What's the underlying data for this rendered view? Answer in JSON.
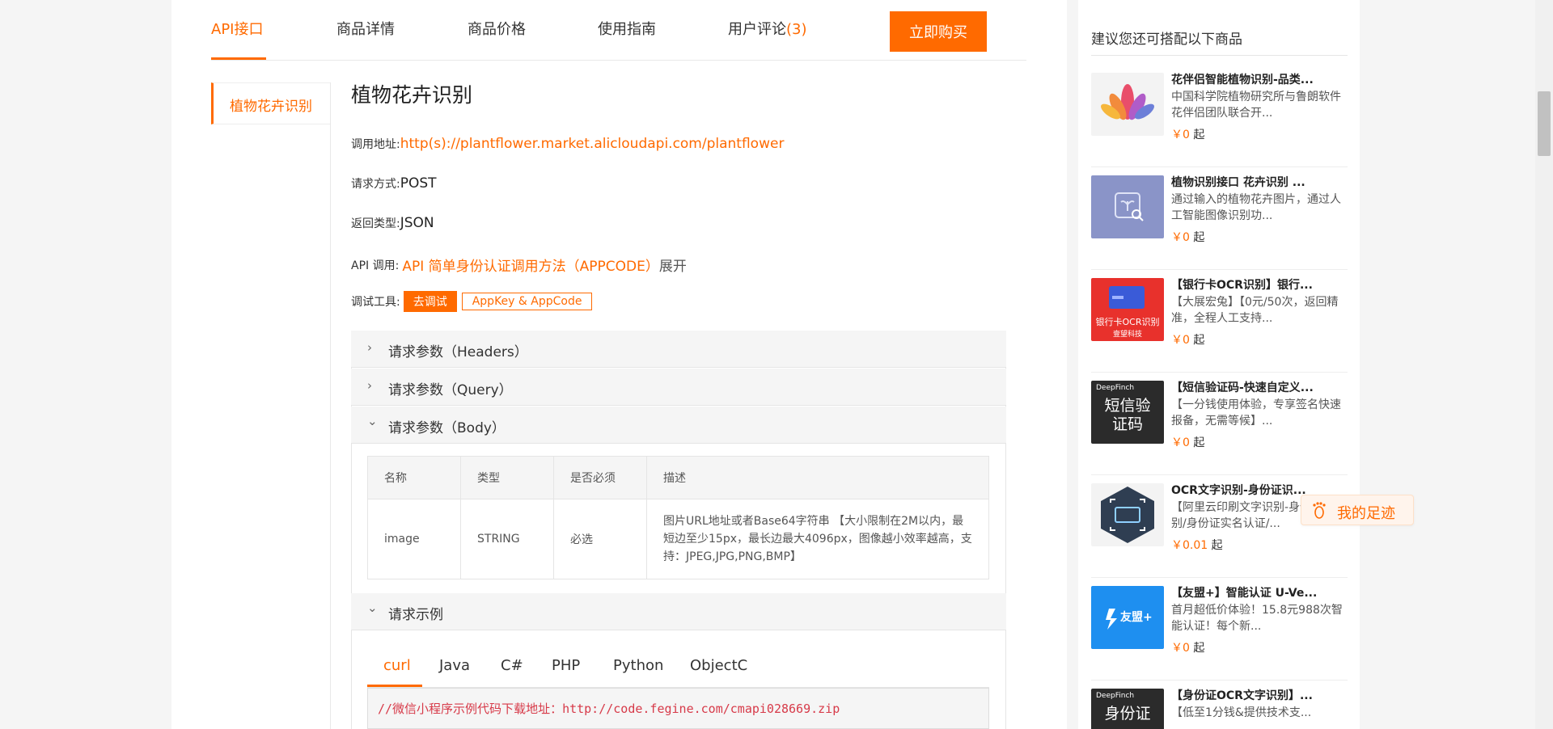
{
  "tabs": [
    {
      "label": "API接口"
    },
    {
      "label": "商品详情"
    },
    {
      "label": "商品价格"
    },
    {
      "label": "使用指南"
    },
    {
      "label": "用户评论",
      "count": "(3)"
    }
  ],
  "buy_button": "立即购买",
  "left_nav": {
    "item": "植物花卉识别"
  },
  "api": {
    "title": "植物花卉识别",
    "address_label": "调用地址:",
    "address": "http(s)://plantflower.market.alicloudapi.com/plantflower",
    "method_label": "请求方式:",
    "method": "POST",
    "return_label": "返回类型:",
    "return_type": "JSON",
    "call_label": "API 调用:",
    "call_link": "API 简单身份认证调用方法（APPCODE）",
    "call_expand": "展开",
    "tool_label": "调试工具:",
    "debug_button": "去调试",
    "appkey_button": "AppKey & AppCode"
  },
  "sections": [
    {
      "label": "请求参数（Headers）",
      "chevron": "›"
    },
    {
      "label": "请求参数（Query）",
      "chevron": "›"
    },
    {
      "label": "请求参数（Body）",
      "chevron": "⌄"
    },
    {
      "label": "请求示例",
      "chevron": "⌄"
    }
  ],
  "param_table": {
    "headers": [
      "名称",
      "类型",
      "是否必须",
      "描述"
    ],
    "rows": [
      {
        "name": "image",
        "type": "STRING",
        "required": "必选",
        "desc": "图片URL地址或者Base64字符串 【大小限制在2M以内，最短边至少15px，最长边最大4096px，图像越小效率越高，支持：JPEG,JPG,PNG,BMP】"
      }
    ]
  },
  "code_tabs": [
    "curl",
    "Java",
    "C#",
    "PHP",
    "Python",
    "ObjectC"
  ],
  "code": {
    "line": "//微信小程序示例代码下载地址：http://code.fegine.com/cmapi028669.zip"
  },
  "recommend": {
    "title": "建议您还可搭配以下商品",
    "currency": "￥",
    "suffix": "起",
    "items": [
      {
        "name": "花伴侣智能植物识别-品类...",
        "desc": "中国科学院植物研究所与鲁朗软件花伴侣团队联合开...",
        "price": "0",
        "icon": "lotus-logo"
      },
      {
        "name": "植物识别接口 花卉识别 ...",
        "desc": "通过输入的植物花卉图片，通过人工智能图像识别功...",
        "price": "0",
        "icon": "plant-scan-logo"
      },
      {
        "name": "【银行卡OCR识别】银行...",
        "desc": "【大展宏兔】【0元/50次，返回精准，全程人工支持...",
        "price": "0",
        "icon": "bank-card-logo",
        "thumb_text": "银行卡OCR识别",
        "thumb_brand": "壹望科技"
      },
      {
        "name": "【短信验证码-快速自定义...",
        "desc": "【一分钱使用体验，专享签名快速报备，无需等候】...",
        "price": "0",
        "icon": "sms-code-logo",
        "thumb_brand": "DeepFinch",
        "thumb_text": "短信验证码"
      },
      {
        "name": "OCR文字识别-身份证识...",
        "desc": "【阿里云印刷文字识别-身份证识别/身份证实名认证/...",
        "price": "0.01",
        "icon": "ocr-scan-logo"
      },
      {
        "name": "【友盟+】智能认证 U-Ve...",
        "desc": "首月超低价体验！15.8元988次智能认证！每个新...",
        "price": "0",
        "icon": "umeng-logo",
        "thumb_text": "友盟+"
      },
      {
        "name": "【身份证OCR文字识别】...",
        "desc": "【低至1分钱&提供技术支...",
        "price": "",
        "icon": "id-ocr-logo",
        "thumb_brand": "DeepFinch",
        "thumb_text": "身份证"
      }
    ]
  },
  "footprint": {
    "label": "我的足迹",
    "icon": "footprint-icon"
  },
  "colors": {
    "accent": "#ff6a00",
    "code_text": "#d73a49"
  }
}
